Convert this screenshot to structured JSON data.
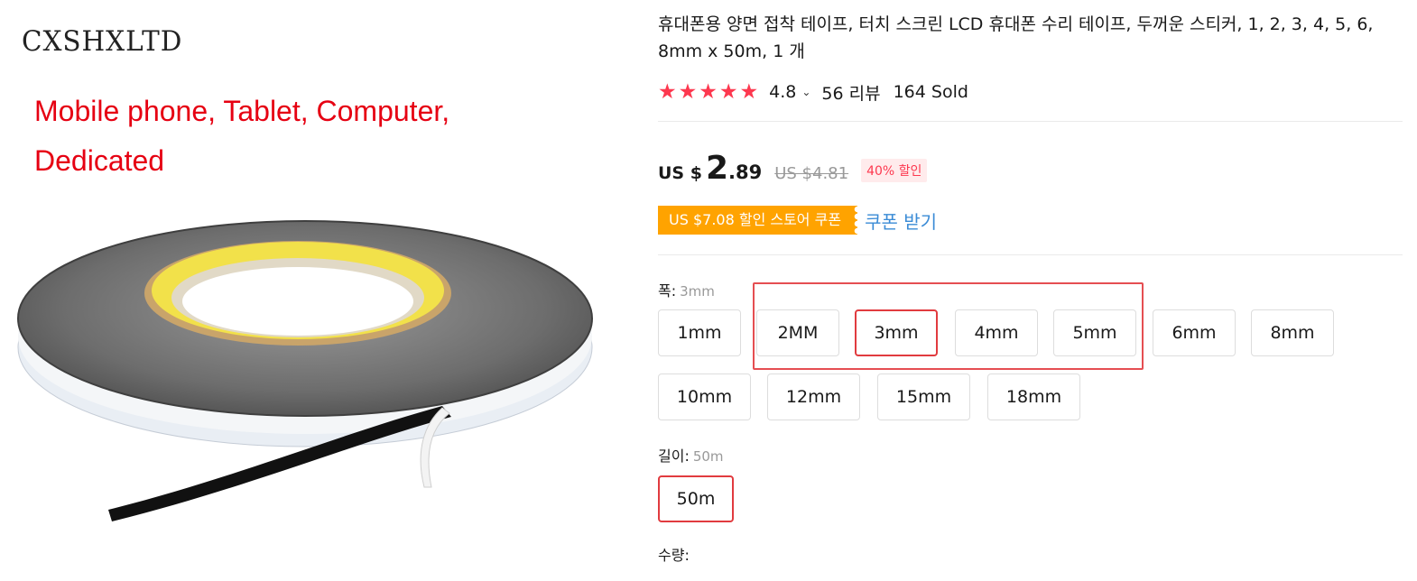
{
  "image": {
    "brand": "CXSHXLTD",
    "promo_line1": "Mobile phone, Tablet, Computer,",
    "promo_line2": "Dedicated"
  },
  "product": {
    "title": "휴대폰용 양면 접착 테이프, 터치 스크린 LCD 휴대폰 수리 테이프, 두꺼운 스티커, 1, 2, 3, 4, 5, 6, 8mm x 50m, 1 개",
    "rating": "4.8",
    "reviews": "56 리뷰",
    "sold": "164 Sold",
    "stars_count": 5
  },
  "price": {
    "currency": "US $",
    "integer": "2",
    "decimal": ".89",
    "original": "US $4.81",
    "discount": "40% 할인"
  },
  "coupon": {
    "label": "US $7.08 할인 스토어 쿠폰",
    "action": "쿠폰 받기"
  },
  "width_option": {
    "label": "폭:",
    "selected": "3mm",
    "options": [
      "1mm",
      "2MM",
      "3mm",
      "4mm",
      "5mm",
      "6mm",
      "8mm",
      "10mm",
      "12mm",
      "15mm",
      "18mm"
    ]
  },
  "length_option": {
    "label": "길이:",
    "selected": "50m",
    "options": [
      "50m"
    ]
  },
  "quantity": {
    "label": "수량:"
  },
  "colors": {
    "accent_red": "#fd384f",
    "coupon_orange": "#ffa300",
    "link_blue": "#3a8bd6"
  }
}
